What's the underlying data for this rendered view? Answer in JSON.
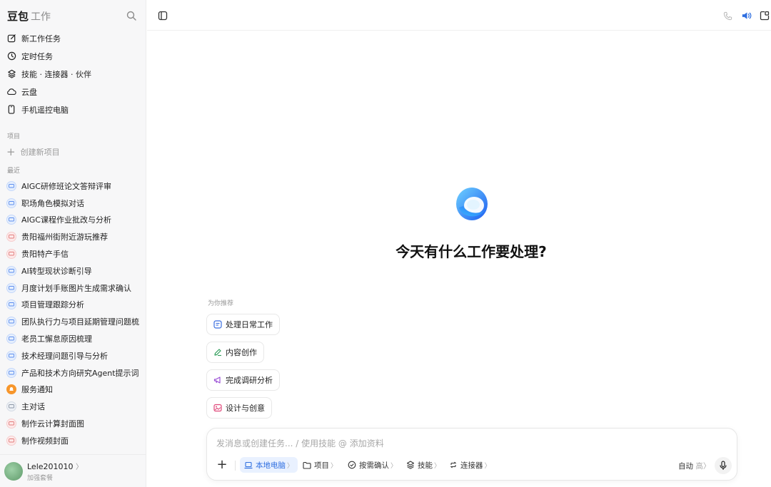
{
  "brand": {
    "name": "豆包",
    "sub": "工作"
  },
  "nav": [
    {
      "label": "新工作任务",
      "icon": "edit-icon"
    },
    {
      "label": "定时任务",
      "icon": "clock-icon"
    },
    {
      "label": "技能 · 连接器 · 伙伴",
      "icon": "layers-icon"
    },
    {
      "label": "云盘",
      "icon": "cloud-icon"
    },
    {
      "label": "手机遥控电脑",
      "icon": "phone-icon"
    }
  ],
  "sections": {
    "projects": "项目",
    "new_project": "创建新项目",
    "recent": "最近"
  },
  "recent": [
    {
      "label": "AIGC研修班论文答辩评审",
      "color": "blue"
    },
    {
      "label": "职场角色模拟对话",
      "color": "blue"
    },
    {
      "label": "AIGC课程作业批改与分析",
      "color": "blue"
    },
    {
      "label": "贵阳福州街附近游玩推荐",
      "color": "pink"
    },
    {
      "label": "贵阳特产手信",
      "color": "pink"
    },
    {
      "label": "AI转型现状诊断引导",
      "color": "blue"
    },
    {
      "label": "月度计划手账图片生成需求确认",
      "color": "blue"
    },
    {
      "label": "项目管理跟踪分析",
      "color": "blue"
    },
    {
      "label": "团队执行力与项目延期管理问题梳",
      "color": "blue"
    },
    {
      "label": "老员工懈怠原因梳理",
      "color": "blue"
    },
    {
      "label": "技术经理问题引导与分析",
      "color": "blue"
    },
    {
      "label": "产品和技术方向研究Agent提示词",
      "color": "blue"
    },
    {
      "label": "服务通知",
      "color": "orange"
    },
    {
      "label": "主对话",
      "color": "gray"
    },
    {
      "label": "制作云计算封面图",
      "color": "pink"
    },
    {
      "label": "制作视频封面",
      "color": "pink"
    }
  ],
  "user": {
    "name": "Lele201010",
    "plan": "加强套餐"
  },
  "main": {
    "headline": "今天有什么工作要处理?",
    "recommend_label": "为你推荐",
    "chips": [
      {
        "label": "处理日常工作",
        "icon": "task-icon",
        "color": "#3b6fe0"
      },
      {
        "label": "内容创作",
        "icon": "pen-icon",
        "color": "#2f9d5a"
      },
      {
        "label": "完成调研分析",
        "icon": "megaphone-icon",
        "color": "#9b4fd6"
      },
      {
        "label": "设计与创意",
        "icon": "image-icon",
        "color": "#e0487a"
      }
    ]
  },
  "composer": {
    "placeholder": "发消息或创建任务... / 使用技能 @ 添加资料",
    "tools": [
      {
        "label": "本地电脑",
        "icon": "laptop-icon",
        "active": true
      },
      {
        "label": "项目",
        "icon": "folder-icon",
        "active": false
      },
      {
        "label": "按需确认",
        "icon": "check-circle-icon",
        "active": false
      },
      {
        "label": "技能",
        "icon": "layers-icon",
        "active": false
      },
      {
        "label": "连接器",
        "icon": "connector-icon",
        "active": false
      }
    ],
    "auto_label": "自动",
    "auto_level": "高",
    "chevron": "〉"
  },
  "colors": {
    "accent": "#2f6fe0",
    "sidebar_bg": "#f7f7f8"
  }
}
